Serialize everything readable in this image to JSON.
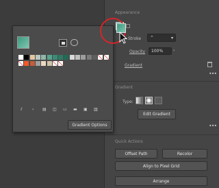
{
  "properties": {
    "appearance_title": "Appearance",
    "stroke_label": "Stroke",
    "opacity_label": "Opacity",
    "opacity_value": "100%",
    "gradient_row_label": "Gradient",
    "gradient_section_title": "Gradient",
    "type_label": "Type:",
    "edit_gradient_button": "Edit Gradient",
    "quick_actions_title": "Quick Actions",
    "offset_path_button": "Offset Path",
    "recolor_button": "Recolor",
    "align_pixel_grid_button": "Align to Pixel Grid",
    "arrange_button": "Arrange"
  },
  "popup": {
    "gradient_options_button": "Gradient Options"
  },
  "colors": {
    "panel_bg": "#454545",
    "popup_bg": "#4b4b4b",
    "fill_gradient_start": "#3d9a7f",
    "fill_gradient_end": "#7fc6b0",
    "highlight_circle": "#d6252a",
    "swatch_row_1": [
      "#ffffff",
      "#000000",
      "#e3c7a3",
      "#b9c9c2",
      "#90b7a9",
      "#5aa38d",
      "#3a8c75",
      "#2e7a64",
      "#1f6b56",
      "#d9d9d9",
      "#bfbfbf",
      "#9d9d9d",
      "#7b7b7b",
      "#5e5e5e",
      "#ffffff",
      "#ffffff"
    ],
    "swatch_row_2": [
      "#ffffff",
      "#f05a28",
      "#c45d3a",
      "#a0a0a0",
      "#e9d8c4",
      "#cfc4a8",
      "#ffffff",
      "#ffffff"
    ]
  },
  "icons": [
    "new-swatch-icon",
    "swatch-libraries-icon",
    "fill-swatch-icon",
    "cursor-arrow-icon",
    "trash-icon",
    "linear-gradient-icon",
    "radial-gradient-icon",
    "freeform-gradient-icon",
    "more-options-icon"
  ]
}
